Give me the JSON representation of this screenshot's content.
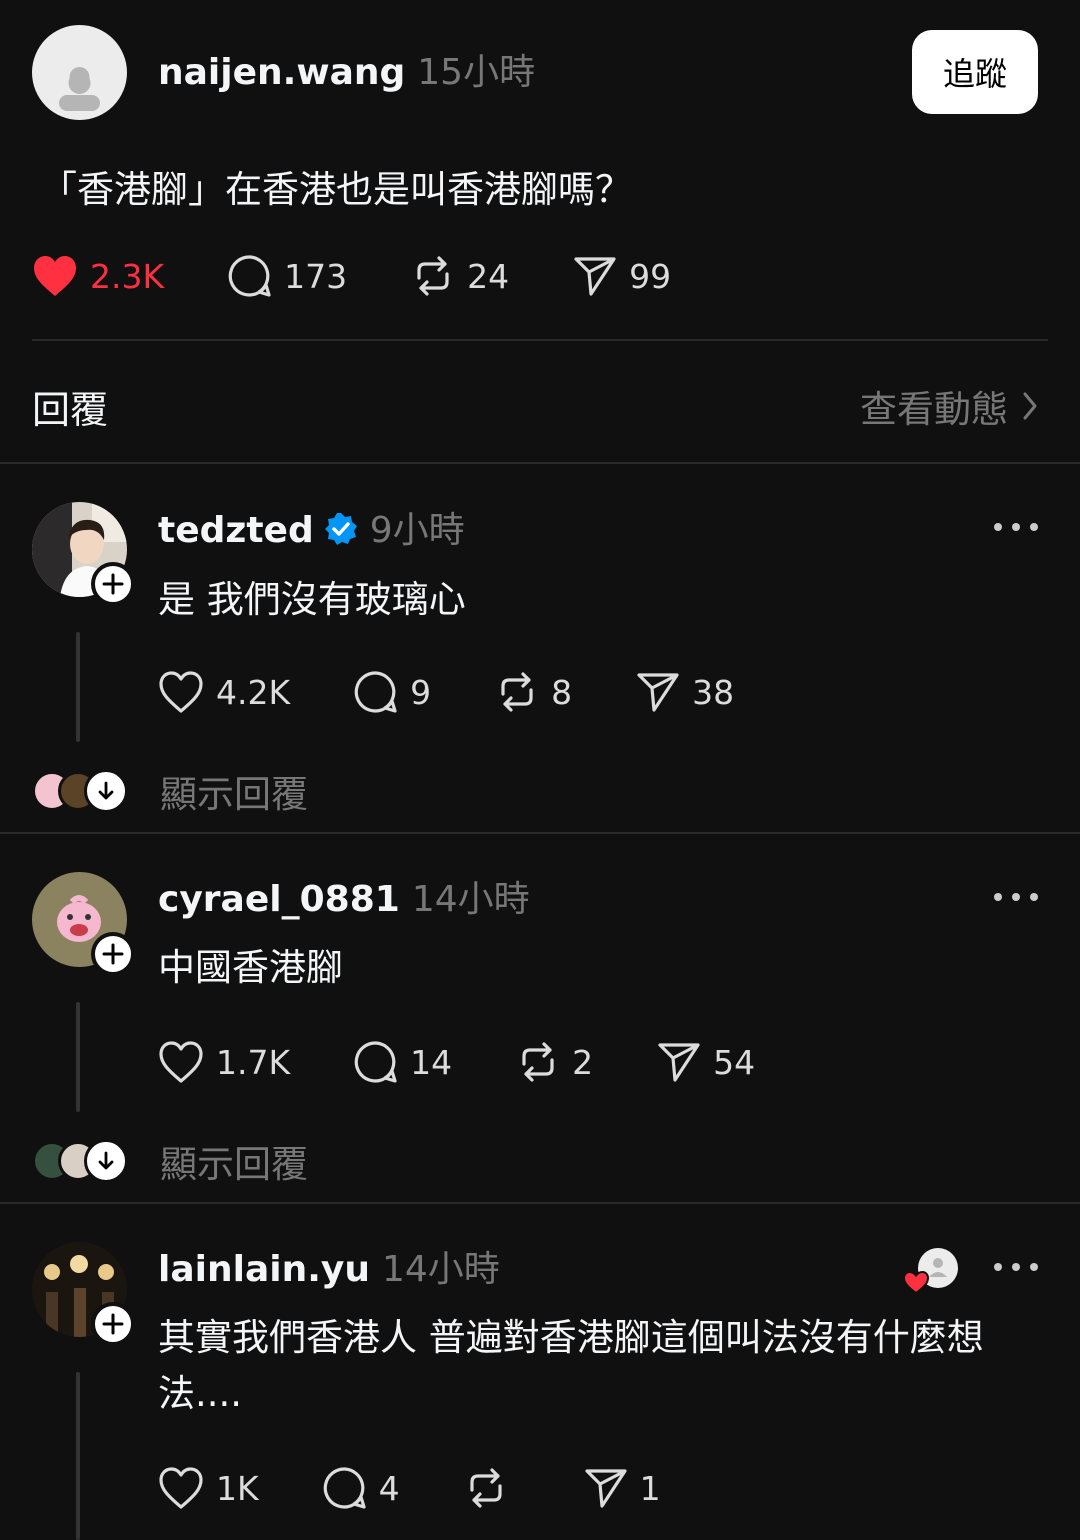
{
  "post": {
    "username": "naijen.wang",
    "time": "15小時",
    "follow_label": "追蹤",
    "text": "「香港腳」在香港也是叫香港腳嗎？",
    "likes": "2.3K",
    "comments": "173",
    "reposts": "24",
    "shares": "99",
    "liked": true
  },
  "replies_header": {
    "title": "回覆",
    "view_activity": "查看動態"
  },
  "replies": [
    {
      "username": "tedzted",
      "verified": true,
      "time": "9小時",
      "text": "是 我們沒有玻璃心",
      "likes": "4.2K",
      "comments": "9",
      "reposts": "8",
      "shares": "38",
      "show_replies": "顯示回覆"
    },
    {
      "username": "cyrael_0881",
      "verified": false,
      "time": "14小時",
      "text": "中國香港腳",
      "likes": "1.7K",
      "comments": "14",
      "reposts": "2",
      "shares": "54",
      "show_replies": "顯示回覆"
    },
    {
      "username": "lainlain.yu",
      "verified": false,
      "time": "14小時",
      "text": "其實我們香港人 普遍對香港腳這個叫法沒有什麼想法....",
      "likes": "1K",
      "comments": "4",
      "reposts": "",
      "shares": "1"
    }
  ],
  "colors": {
    "background": "#101010",
    "text": "#f3f5f7",
    "muted": "#777777",
    "like_red": "#ff3040",
    "verified_blue": "#0095f6"
  }
}
